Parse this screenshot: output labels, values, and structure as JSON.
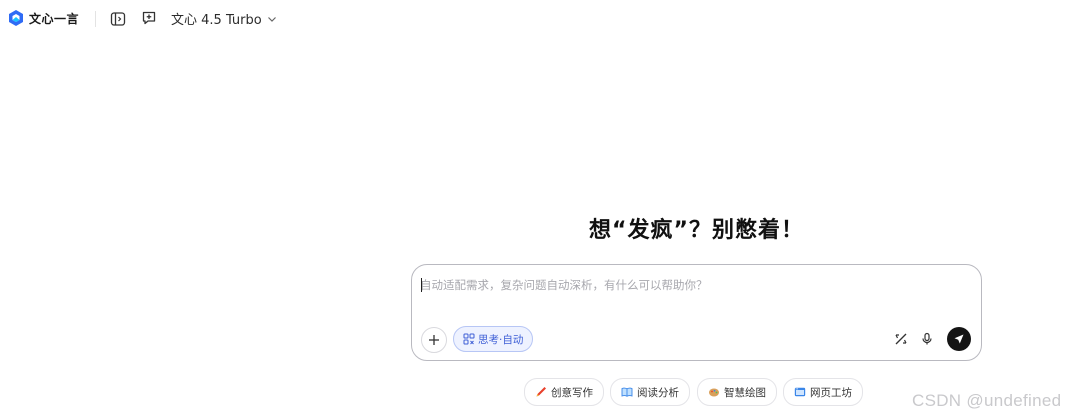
{
  "app": {
    "name": "文心一言"
  },
  "header": {
    "model_name": "文心 4.5 Turbo",
    "icons": [
      "sidebar-toggle-icon",
      "new-chat-icon",
      "chevron-down-icon"
    ]
  },
  "main": {
    "headline": "想“发疯”？别憋着！",
    "input_placeholder": "自动适配需求，复杂问题自动深析，有什么可以帮助你？",
    "think_chip_label": "思考·自动"
  },
  "suggestions": [
    {
      "label": "创意写作",
      "icon": "pen-icon"
    },
    {
      "label": "阅读分析",
      "icon": "book-icon"
    },
    {
      "label": "智慧绘图",
      "icon": "palette-icon"
    },
    {
      "label": "网页工坊",
      "icon": "webpage-icon"
    }
  ],
  "watermark": "CSDN @undefined",
  "colors": {
    "accent": "#3e5fd6",
    "logo_blue": "#2f6bf5",
    "send": "#141414"
  }
}
